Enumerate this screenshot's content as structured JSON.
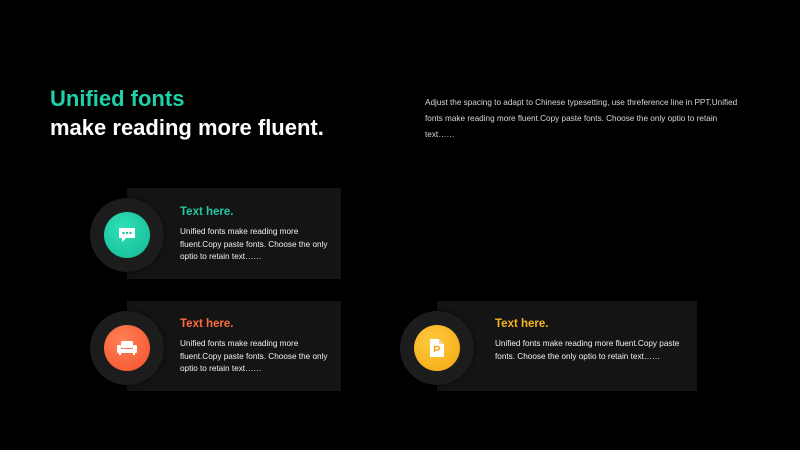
{
  "header": {
    "title_line1": "Unified fonts",
    "title_line2": "make reading more fluent.",
    "description": "Adjust the spacing to adapt to Chinese typesetting, use threference line in PPT.Unified fonts make reading more fluent.Copy paste fonts. Choose the only optio to retain text……"
  },
  "colors": {
    "background": "#000000",
    "teal": "#1fd1a8",
    "orange": "#ff6a3d",
    "yellow": "#f7b521",
    "card": "#141414"
  },
  "cards": [
    {
      "heading": "Text here.",
      "text": "Unified fonts make reading more fluent.Copy paste fonts. Choose the only optio to retain text……",
      "icon": "chat-bubble-icon",
      "color": "#1fc9a4"
    },
    {
      "heading": "Text here.",
      "text": "Unified fonts make reading more fluent.Copy paste fonts. Choose the only optio to retain text……",
      "icon": "sofa-icon",
      "color": "#ff6a3d"
    },
    {
      "heading": "Text here.",
      "text": "Unified fonts make reading more fluent.Copy paste fonts. Choose the only optio to retain text……",
      "icon": "document-icon",
      "color": "#f7b521"
    }
  ]
}
